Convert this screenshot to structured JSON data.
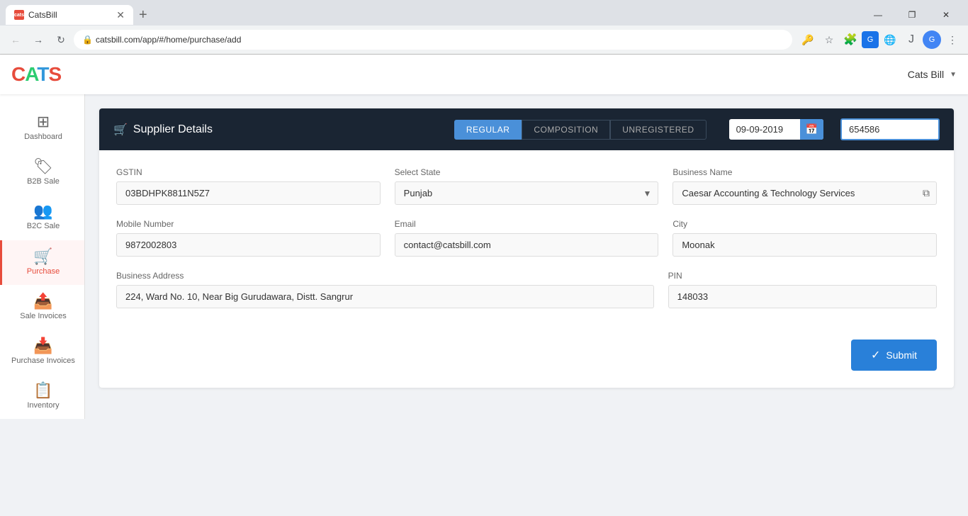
{
  "browser": {
    "tab_favicon": "cats",
    "tab_title": "CatsBill",
    "url": "catsbill.com/app/#/home/purchase/add",
    "window_controls": {
      "minimize": "—",
      "maximize": "❐",
      "close": "✕"
    }
  },
  "app": {
    "logo_letters": [
      "C",
      "A",
      "T",
      "S"
    ],
    "header_title": "Cats Bill",
    "header_dropdown": "▼"
  },
  "sidebar": {
    "items": [
      {
        "id": "dashboard",
        "label": "Dashboard",
        "icon": "⊞"
      },
      {
        "id": "b2b-sale",
        "label": "B2B Sale",
        "icon": "🏷"
      },
      {
        "id": "b2c-sale",
        "label": "B2C Sale",
        "icon": "👥"
      },
      {
        "id": "purchase",
        "label": "Purchase",
        "icon": "🛒",
        "active": true
      },
      {
        "id": "sale-invoices",
        "label": "Sale Invoices",
        "icon": "📤"
      },
      {
        "id": "purchase-invoices",
        "label": "Purchase Invoices",
        "icon": "📥"
      },
      {
        "id": "inventory",
        "label": "Inventory",
        "icon": "📋"
      }
    ]
  },
  "form": {
    "title": "Supplier Details",
    "title_icon": "🛒",
    "tabs": [
      {
        "id": "regular",
        "label": "REGULAR",
        "active": true
      },
      {
        "id": "composition",
        "label": "COMPOSITION",
        "active": false
      },
      {
        "id": "unregistered",
        "label": "UNREGISTERED",
        "active": false
      }
    ],
    "date": "09-09-2019",
    "date_icon": "📅",
    "invoice_number": "654586",
    "fields": {
      "gstin": {
        "label": "GSTIN",
        "value": "03BDHPK8811N5Z7",
        "placeholder": ""
      },
      "select_state": {
        "label": "Select State",
        "value": "Punjab",
        "placeholder": "Punjab"
      },
      "business_name": {
        "label": "Business Name",
        "value": "Caesar Accounting & Technology Services"
      },
      "mobile_number": {
        "label": "Mobile Number",
        "value": "9872002803"
      },
      "email": {
        "label": "Email",
        "value": "contact@catsbill.com"
      },
      "city": {
        "label": "City",
        "value": "Moonak"
      },
      "business_address": {
        "label": "Business Address",
        "value": "224, Ward No. 10, Near Big Gurudawara, Distt. Sangrur"
      },
      "pin": {
        "label": "PIN",
        "value": "148033"
      }
    },
    "submit_label": "Submit",
    "submit_icon": "✓"
  },
  "colors": {
    "logo_c": "#e74c3c",
    "logo_a": "#2ecc71",
    "logo_t": "#3498db",
    "logo_s": "#e74c3c",
    "header_bg": "#1a2533",
    "active_tab": "#4a90d9",
    "active_sidebar": "#e74c3c",
    "submit_btn": "#2980d9"
  }
}
